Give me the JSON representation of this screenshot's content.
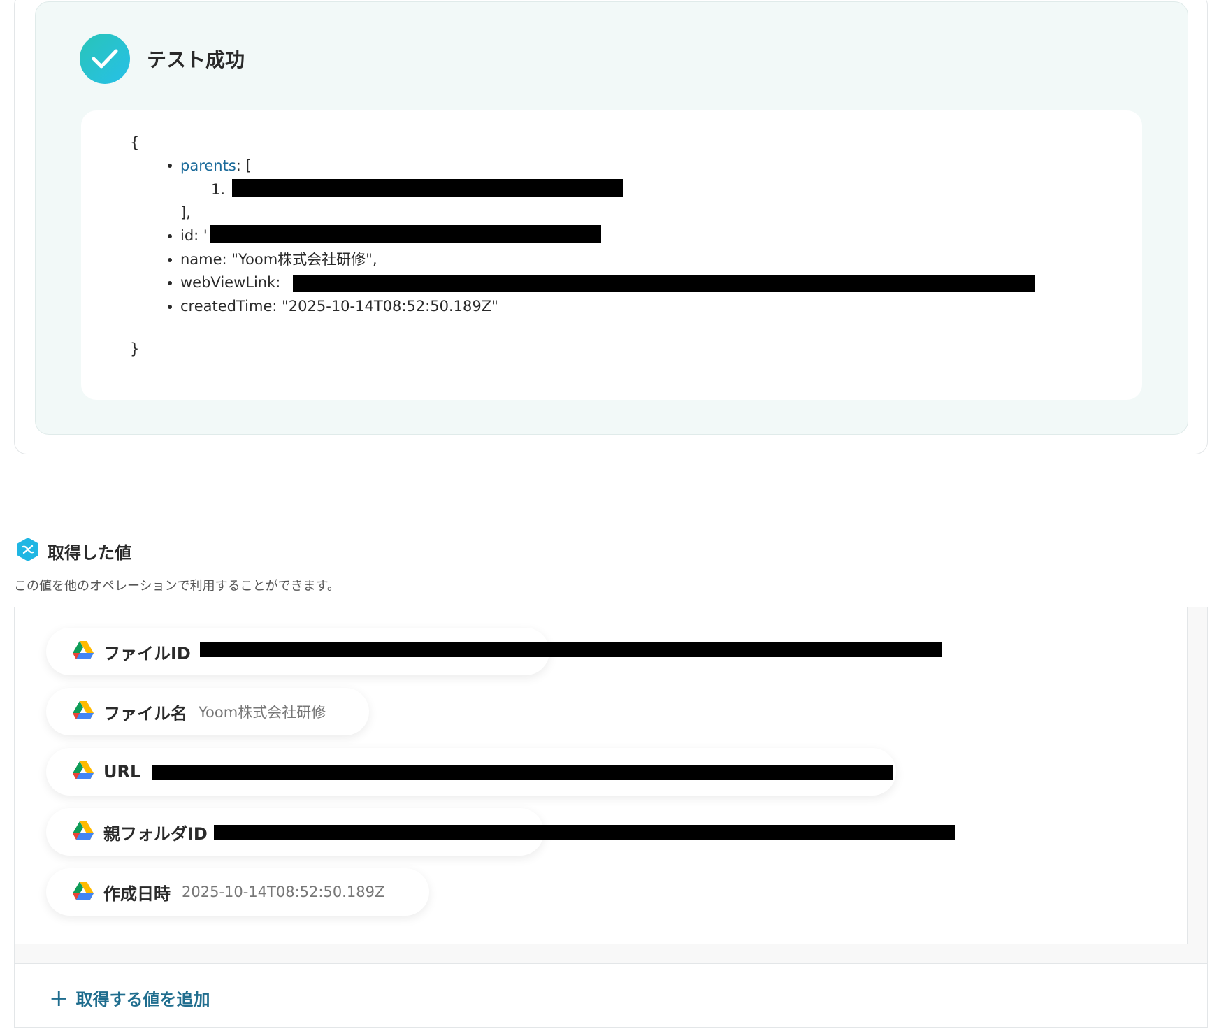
{
  "test_result": {
    "title": "テスト成功",
    "json_open": "{",
    "json_close": "}",
    "lines": {
      "parents_key": "parents",
      "parents_open": ": [",
      "parents_item_index": "1.",
      "parents_close": "],",
      "id_key": "id: '",
      "name_line": "name: \"Yoom株式会社研修\",",
      "webviewlink_key": "webViewLink:",
      "createdtime_line": "createdTime: \"2025-10-14T08:52:50.189Z\""
    }
  },
  "values_section": {
    "title": "取得した値",
    "description": "この値を他のオペレーションで利用することができます。",
    "items": [
      {
        "label": "ファイルID",
        "value": "",
        "redacted": true
      },
      {
        "label": "ファイル名",
        "value": "Yoom株式会社研修",
        "redacted": false
      },
      {
        "label": "URL",
        "value": "",
        "redacted": true
      },
      {
        "label": "親フォルダID",
        "value": "",
        "redacted": true
      },
      {
        "label": "作成日時",
        "value": "2025-10-14T08:52:50.189Z",
        "redacted": false
      }
    ],
    "add_button_label": "取得する値を追加"
  },
  "colors": {
    "accent_teal": "#27c0c8",
    "link_blue": "#1f6d8e",
    "panel_bg": "#f2f9f8"
  },
  "icons": {
    "success": "check-circle-icon",
    "values": "variable-hexagon-icon",
    "drive": "google-drive-icon",
    "add": "plus-icon"
  }
}
